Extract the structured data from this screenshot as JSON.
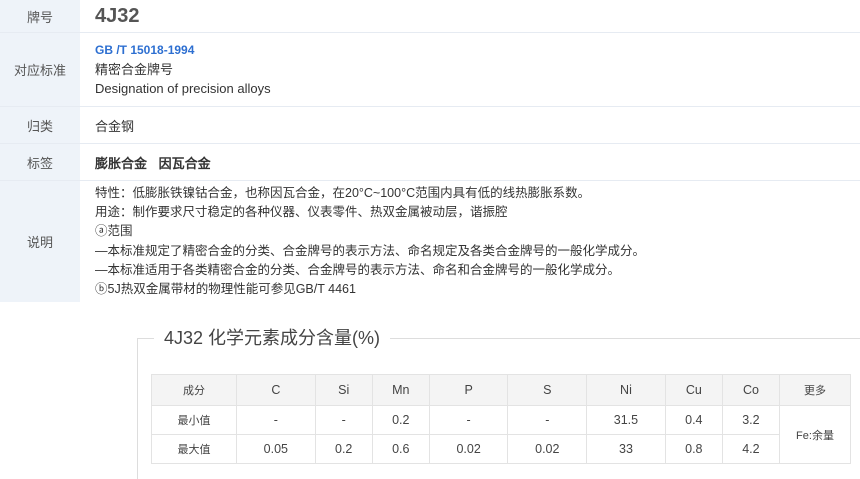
{
  "info": {
    "grade_label": "牌号",
    "grade_value": "4J32",
    "standard_label": "对应标准",
    "standard_code": "GB /T 15018-1994",
    "standard_title_cn": "精密合金牌号",
    "standard_title_en": "Designation of precision alloys",
    "category_label": "归类",
    "category_value": "合金钢",
    "tags_label": "标签",
    "tags": [
      "膨胀合金",
      "因瓦合金"
    ],
    "desc_label": "说明",
    "desc_lines": [
      "特性：低膨胀铁镍钴合金，也称因瓦合金，在20°C~100°C范围内具有低的线热膨胀系数。",
      "用途：制作要求尺寸稳定的各种仪器、仪表零件、热双金属被动层，谐振腔",
      "ⓐ范围",
      "—本标准规定了精密合金的分类、合金牌号的表示方法、命名规定及各类合金牌号的一般化学成分。",
      "—本标准适用于各类精密合金的分类、合金牌号的表示方法、命名和合金牌号的一般化学成分。",
      "ⓑ5J热双金属带材的物理性能可参见GB/T 4461"
    ]
  },
  "chemistry": {
    "title": "4J32 化学元素成分含量(%)",
    "header_first": "成分",
    "elements": [
      "C",
      "Si",
      "Mn",
      "P",
      "S",
      "Ni",
      "Cu",
      "Co"
    ],
    "header_more": "更多",
    "min_label": "最小值",
    "min_values": [
      "-",
      "-",
      "0.2",
      "-",
      "-",
      "31.5",
      "0.4",
      "3.2"
    ],
    "max_label": "最大值",
    "max_values": [
      "0.05",
      "0.2",
      "0.6",
      "0.02",
      "0.02",
      "33",
      "0.8",
      "4.2"
    ],
    "more_value": "Fe:余量"
  }
}
